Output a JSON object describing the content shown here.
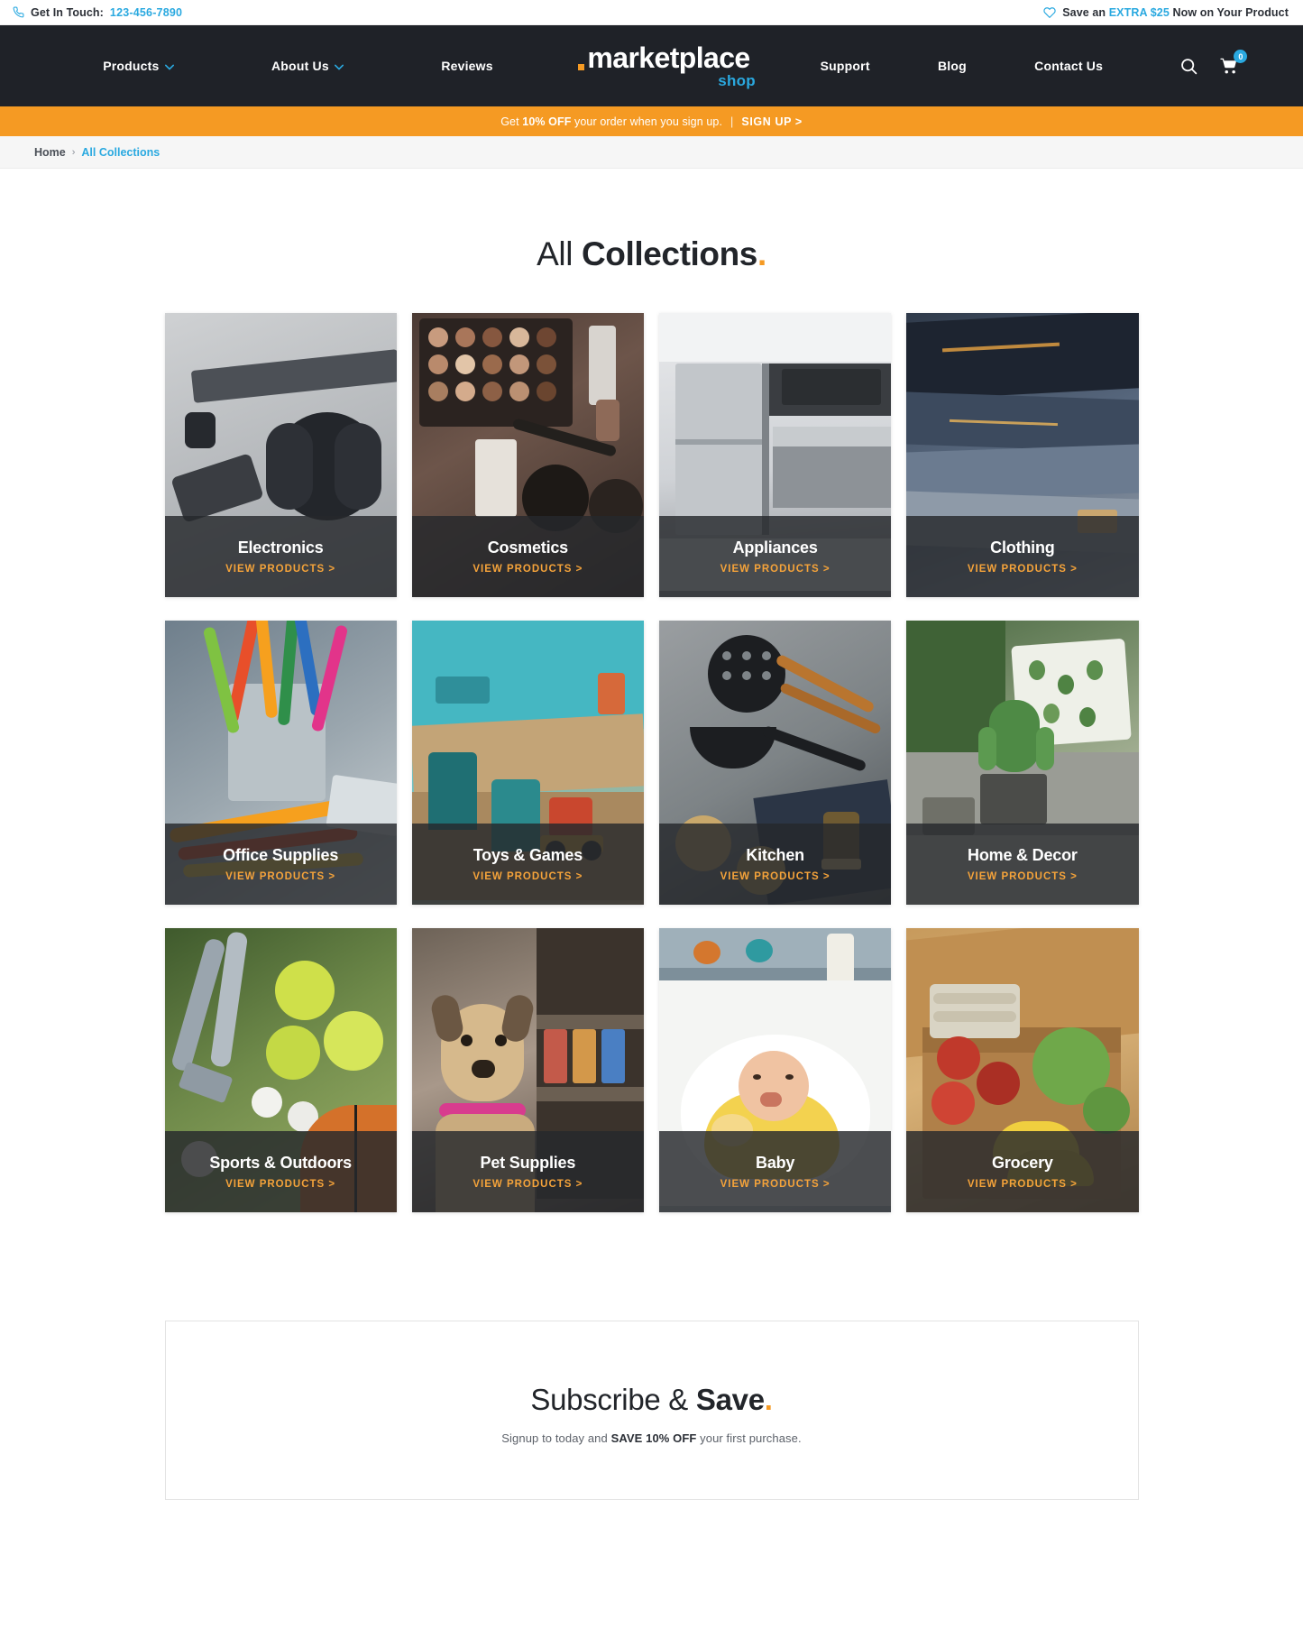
{
  "topbar": {
    "phone_icon": "phone-icon",
    "contact_label": "Get In Touch:",
    "phone_number": "123-456-7890",
    "heart_icon": "heart-icon",
    "promo_prefix": "Save an",
    "promo_highlight": "EXTRA $25",
    "promo_suffix": "Now on Your Product"
  },
  "nav": {
    "left_items": [
      {
        "label": "Products",
        "has_caret": true
      },
      {
        "label": "About Us",
        "has_caret": true
      },
      {
        "label": "Reviews",
        "has_caret": false
      }
    ],
    "right_items": [
      {
        "label": "Support",
        "has_caret": false
      },
      {
        "label": "Blog",
        "has_caret": false
      },
      {
        "label": "Contact Us",
        "has_caret": false
      }
    ],
    "logo_main": "marketplace",
    "logo_sub": "shop",
    "search_icon": "search-icon",
    "cart_icon": "cart-icon",
    "cart_count": "0"
  },
  "promo_strip": {
    "prefix": "Get",
    "highlight": "10% OFF",
    "suffix": "your order when you sign up.",
    "separator": "|",
    "cta": "SIGN UP >"
  },
  "breadcrumb": {
    "home": "Home",
    "separator": "›",
    "current": "All Collections"
  },
  "page": {
    "title_light": "All",
    "title_strong": "Collections",
    "title_dot": "."
  },
  "collections": {
    "cta_label": "VIEW PRODUCTS >",
    "items": [
      {
        "title": "Electronics",
        "scene": "sc-electronics"
      },
      {
        "title": "Cosmetics",
        "scene": "sc-cosmetics"
      },
      {
        "title": "Appliances",
        "scene": "sc-appliances"
      },
      {
        "title": "Clothing",
        "scene": "sc-clothing"
      },
      {
        "title": "Office Supplies",
        "scene": "sc-office"
      },
      {
        "title": "Toys & Games",
        "scene": "sc-toys"
      },
      {
        "title": "Kitchen",
        "scene": "sc-kitchen"
      },
      {
        "title": "Home & Decor",
        "scene": "sc-home"
      },
      {
        "title": "Sports & Outdoors",
        "scene": "sc-sports"
      },
      {
        "title": "Pet Supplies",
        "scene": "sc-pets"
      },
      {
        "title": "Baby",
        "scene": "sc-baby"
      },
      {
        "title": "Grocery",
        "scene": "sc-grocery"
      }
    ]
  },
  "subscribe": {
    "title_light": "Subscribe & ",
    "title_strong": "Save",
    "title_dot": ".",
    "sub_prefix": "Signup to today and",
    "sub_highlight": "SAVE 10% OFF",
    "sub_suffix": "your first purchase."
  },
  "colors": {
    "accent_orange": "#f59a23",
    "accent_blue": "#2aa9e0",
    "nav_dark": "#1f2228",
    "cta_orange": "#f5a33a"
  }
}
